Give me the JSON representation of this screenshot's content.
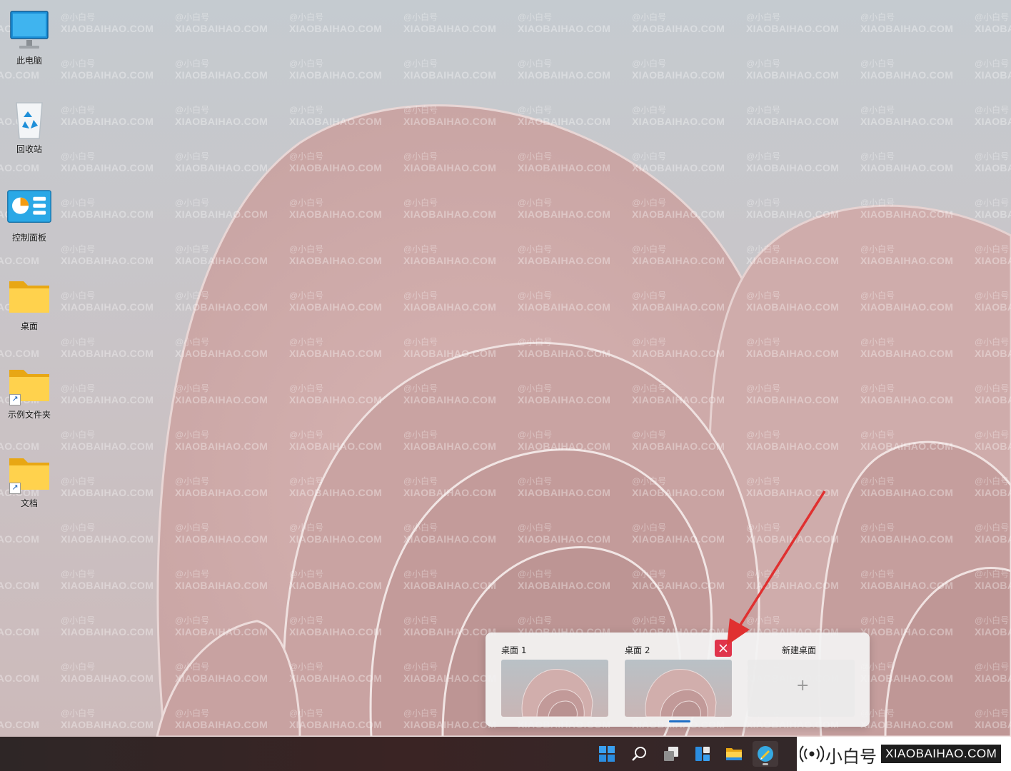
{
  "desktop": {
    "icons": [
      {
        "label": "此电脑",
        "icon": "monitor-icon"
      },
      {
        "label": "回收站",
        "icon": "recycle-bin-icon"
      },
      {
        "label": "控制面板",
        "icon": "control-panel-icon"
      },
      {
        "label": "桌面",
        "icon": "folder-icon"
      },
      {
        "label": "示例文件夹",
        "icon": "folder-shortcut-icon"
      },
      {
        "label": "文档",
        "icon": "folder-shortcut-icon"
      }
    ]
  },
  "watermark": {
    "line1": "@小白号",
    "line2": "XIAOBAIHAO.COM"
  },
  "task_view": {
    "desktops": [
      {
        "label": "桌面 1",
        "active": false
      },
      {
        "label": "桌面 2",
        "active": true
      }
    ],
    "new_desktop_label": "新建桌面",
    "new_desktop_plus": "+"
  },
  "taskbar": {
    "items": [
      "start-icon",
      "search-icon",
      "task-view-icon",
      "widgets-icon",
      "file-explorer-icon",
      "app-icon"
    ],
    "colors": {
      "accent": "#1f6fc5",
      "close": "#e0344b"
    }
  },
  "brand": {
    "cn": "小白号",
    "en": "XIAOBAIHAO.COM"
  }
}
